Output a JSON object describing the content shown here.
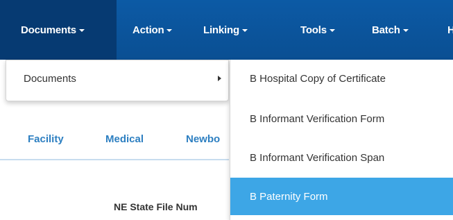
{
  "nav": {
    "items": [
      {
        "label": "Documents"
      },
      {
        "label": "Action"
      },
      {
        "label": "Linking"
      },
      {
        "label": "Tools"
      },
      {
        "label": "Batch"
      },
      {
        "label": "H"
      }
    ]
  },
  "tabs": [
    {
      "label": "Facility"
    },
    {
      "label": "Medical"
    },
    {
      "label": "Newbo"
    }
  ],
  "form": {
    "field_label": "NE State File Num"
  },
  "documents_menu": {
    "items": [
      {
        "label": "Documents"
      }
    ]
  },
  "documents_submenu": {
    "items": [
      {
        "label": "B Hospital Copy of Certificate"
      },
      {
        "label": "B Informant Verification Form"
      },
      {
        "label": "B Informant Verification Span"
      },
      {
        "label": "B Paternity Form",
        "selected": true
      }
    ]
  },
  "colors": {
    "nav_bg": "#0a4f93",
    "nav_active": "#063a72",
    "tab_text": "#2d7fc1",
    "highlight": "#3da6e6"
  }
}
